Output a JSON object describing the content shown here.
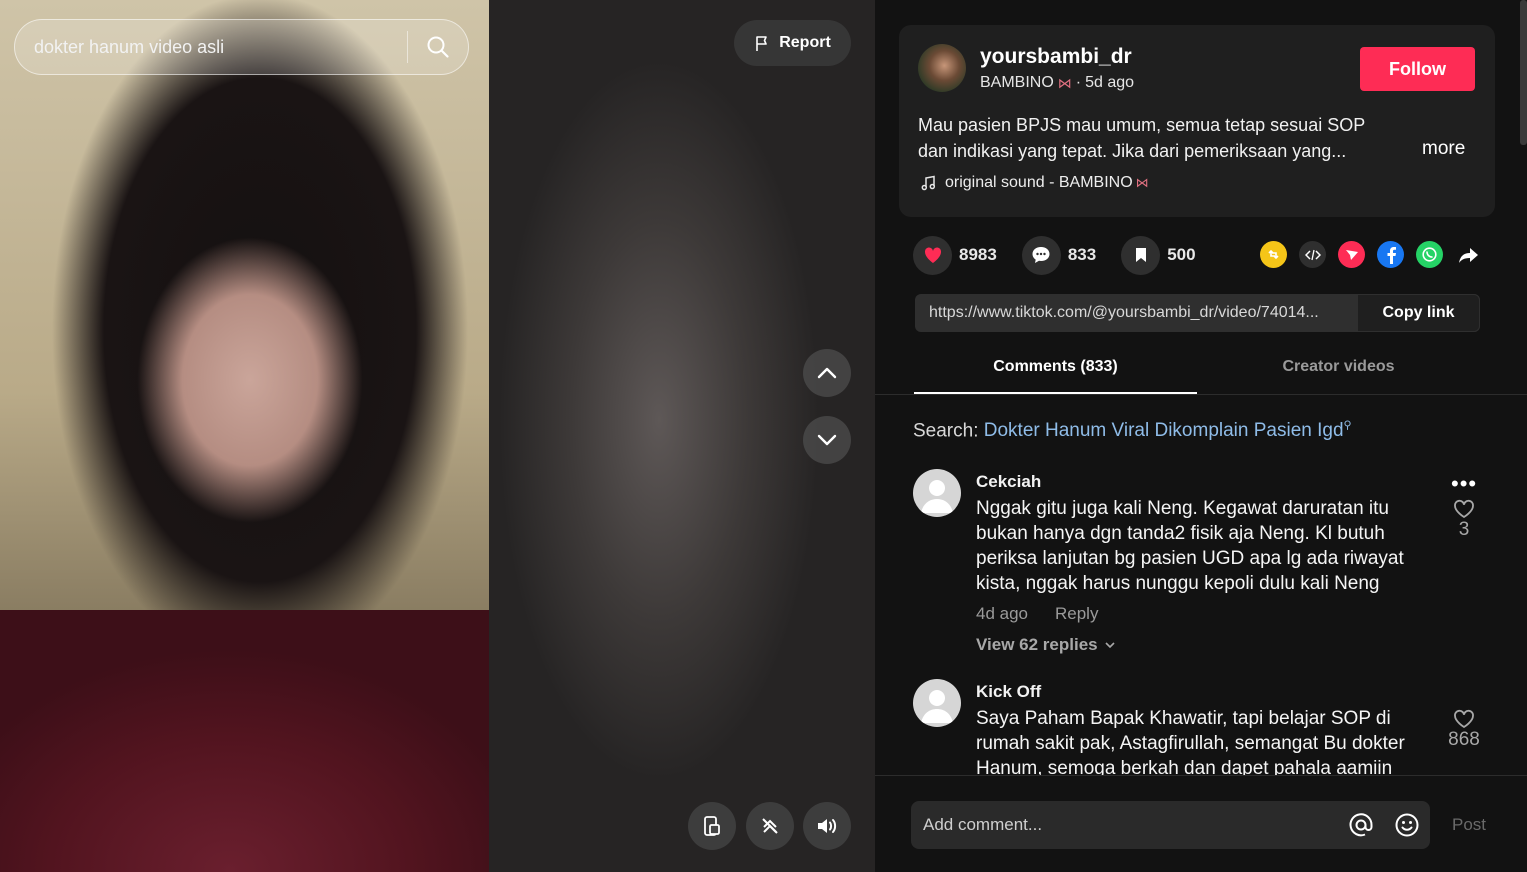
{
  "search": {
    "query": "dokter hanum video asli"
  },
  "video": {
    "report_label": "Report",
    "controls": [
      "mini-player-icon",
      "auto-scroll-icon",
      "volume-icon"
    ]
  },
  "author": {
    "username": "yoursbambi_dr",
    "display_name": "BAMBINO",
    "time_ago": "5d ago",
    "follow_label": "Follow"
  },
  "post": {
    "description": "Mau pasien BPJS mau umum, semua tetap sesuai SOP dan indikasi yang tepat. Jika dari pemeriksaan yang...",
    "more_label": "more",
    "sound": "original sound - BAMBINO"
  },
  "stats": {
    "likes": "8983",
    "comments": "833",
    "saves": "500"
  },
  "share": {
    "icons": [
      "repost-icon",
      "embed-icon",
      "send-icon",
      "facebook-icon",
      "whatsapp-icon",
      "share-arrow-icon"
    ],
    "link": "https://www.tiktok.com/@yoursbambi_dr/video/74014...",
    "copy_label": "Copy link"
  },
  "tabs": [
    {
      "label": "Comments (833)",
      "active": true
    },
    {
      "label": "Creator videos",
      "active": false
    }
  ],
  "search_suggest": {
    "prefix": "Search:",
    "term": "Dokter Hanum Viral Dikomplain Pasien Igd"
  },
  "comments": [
    {
      "name": "Cekciah",
      "text": "Nggak gitu juga kali Neng. Kegawat daruratan itu bukan hanya dgn tanda2 fisik aja Neng. Kl butuh periksa lanjutan bg pasien UGD apa lg ada riwayat kista, nggak harus nunggu kepoli dulu kali Neng",
      "time": "4d ago",
      "reply_label": "Reply",
      "replies_label": "View 62 replies",
      "likes": "3",
      "more": "•••"
    },
    {
      "name": "Kick Off",
      "text": "Saya Paham Bapak Khawatir, tapi belajar SOP di rumah sakit pak, Astagfirullah, semangat Bu dokter Hanum, semoga berkah dan dapet pahala aamiin",
      "likes": "868"
    }
  ],
  "composer": {
    "placeholder": "Add comment...",
    "post_label": "Post"
  },
  "colors": {
    "accent": "#fe2c55",
    "link": "#8fbce8",
    "panel": "#121212",
    "card": "#1f1f1f"
  }
}
